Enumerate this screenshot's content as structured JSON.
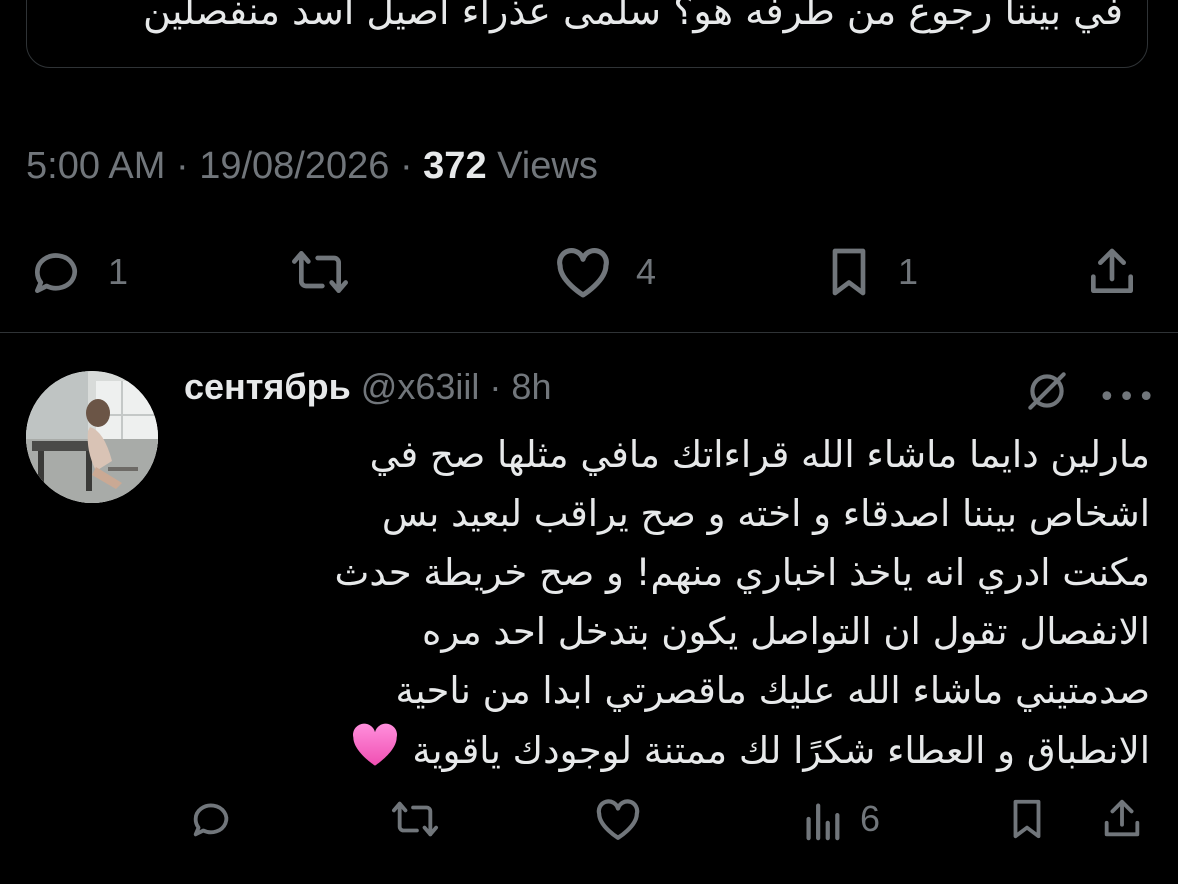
{
  "quoted": {
    "text": "في بيننا رجوع من طرفه هو؟ سلمى عذراء أصيل أسد منفصلين"
  },
  "main_tweet": {
    "time": "5:00 AM",
    "date": "19/08/2026",
    "views_count": "372",
    "views_label": "Views",
    "sep": "·",
    "actions": {
      "reply_count": "1",
      "retweet_count": "",
      "like_count": "4",
      "bookmark_count": "1"
    }
  },
  "reply": {
    "name": "сентябрь",
    "handle": "@x63iil",
    "sep": "·",
    "time": "8h",
    "lines": [
      "مارلين دايما ماشاء الله قراءاتك مافي مثلها صح في",
      "اشخاص بيننا اصدقاء و اخته و صح يراقب لبعيد بس",
      "مكنت ادري انه ياخذ اخباري منهم! و صح خريطة حدث",
      "الانفصال تقول ان التواصل يكون بتدخل احد مره",
      "صدمتيني ماشاء الله عليك ماقصرتي ابدا من ناحية",
      "الانطباق و العطاء شكرًا لك ممتنة لوجودك ياقوية"
    ],
    "actions": {
      "views_count": "6"
    }
  },
  "colors": {
    "background": "#000000",
    "text": "#e7e9ea",
    "muted": "#71767b",
    "border": "#2f3336",
    "heart_emoji": "#ff5fc4"
  },
  "icons": [
    "reply-icon",
    "retweet-icon",
    "like-icon",
    "bookmark-icon",
    "share-icon",
    "views-icon",
    "mute-icon",
    "more-icon",
    "pink-heart-emoji"
  ]
}
